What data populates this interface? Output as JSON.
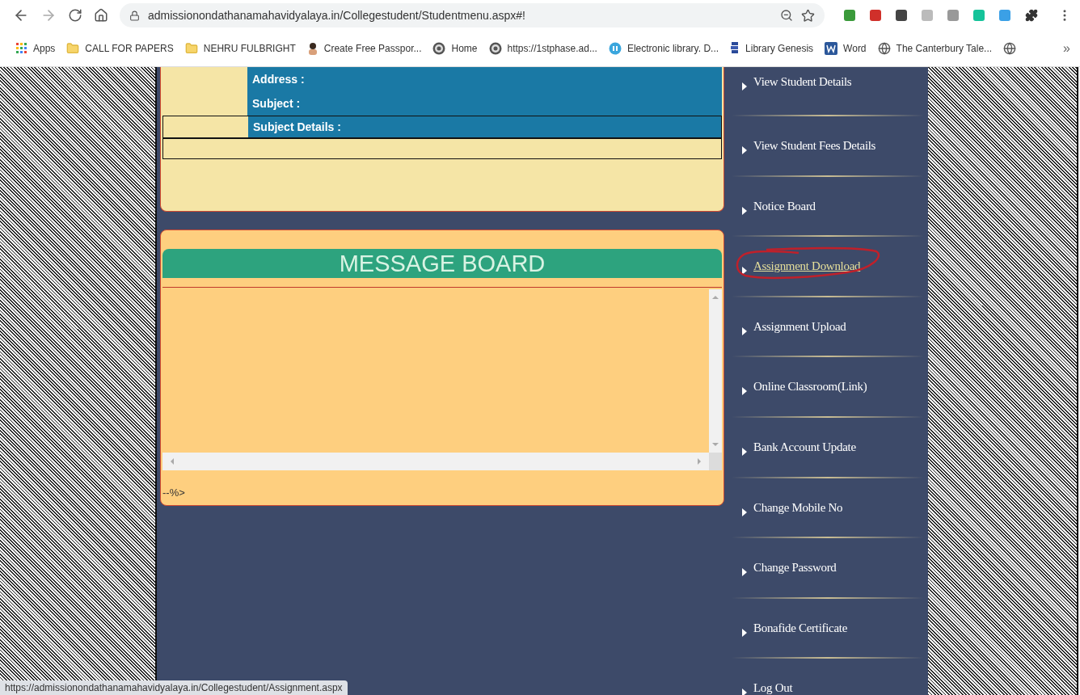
{
  "browser": {
    "url": "admissionondathanamahavidyalaya.in/Collegestudent/Studentmenu.aspx#!",
    "bookmarks": [
      {
        "kind": "apps",
        "label": "Apps"
      },
      {
        "kind": "folder",
        "label": "CALL FOR PAPERS"
      },
      {
        "kind": "folder",
        "label": "NEHRU FULBRIGHT"
      },
      {
        "kind": "person",
        "label": "Create Free Passpor..."
      },
      {
        "kind": "seal",
        "label": "Home"
      },
      {
        "kind": "seal",
        "label": "https://1stphase.ad..."
      },
      {
        "kind": "circle",
        "label": "Electronic library. D..."
      },
      {
        "kind": "books",
        "label": "Library Genesis"
      },
      {
        "kind": "word",
        "label": "Word"
      },
      {
        "kind": "globe",
        "label": "The Canterbury Tale..."
      },
      {
        "kind": "globe"
      }
    ],
    "more": "»"
  },
  "details": {
    "rows": [
      {
        "label": "Address :",
        "boxed": false
      },
      {
        "label": "Subject :",
        "boxed": false
      },
      {
        "label": "Subject Details :",
        "boxed": true
      }
    ]
  },
  "message_board": {
    "title": "MESSAGE BOARD",
    "footer": "--%>"
  },
  "menu": [
    {
      "label": "View Student Details",
      "hovered": false,
      "circled": false
    },
    {
      "label": "View Student Fees Details",
      "hovered": false,
      "circled": false
    },
    {
      "label": "Notice Board",
      "hovered": false,
      "circled": false
    },
    {
      "label": "Assignment Download",
      "hovered": true,
      "circled": true
    },
    {
      "label": "Assignment Upload",
      "hovered": false,
      "circled": false
    },
    {
      "label": "Online Classroom(Link)",
      "hovered": false,
      "circled": false
    },
    {
      "label": "Bank Account Update",
      "hovered": false,
      "circled": false
    },
    {
      "label": "Change Mobile No",
      "hovered": false,
      "circled": false
    },
    {
      "label": "Change Password",
      "hovered": false,
      "circled": false
    },
    {
      "label": "Bonafide Certificate",
      "hovered": false,
      "circled": false
    },
    {
      "label": "Log Out",
      "hovered": false,
      "circled": false
    }
  ],
  "status_bar": {
    "url": "https://admissionondathanamahavidyalaya.in/Collegestudent/Assignment.aspx"
  }
}
